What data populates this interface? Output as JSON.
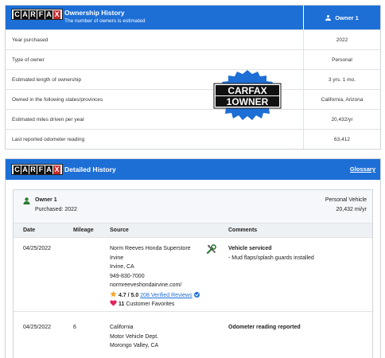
{
  "logo_text": "CARFAX",
  "ownership": {
    "title": "Ownership History",
    "subtitle": "The number of owners is estimated",
    "owner_column": "Owner 1",
    "rows": [
      {
        "label": "Year purchased",
        "value": "2022"
      },
      {
        "label": "Type of owner",
        "value": "Personal"
      },
      {
        "label": "Estimated length of ownership",
        "value": "3 yrs. 1 mo."
      },
      {
        "label": "Owned in the following states/provinces",
        "value": "California, Arizona"
      },
      {
        "label": "Estimated miles driven per year",
        "value": "20,432/yr"
      },
      {
        "label": "Last reported odometer reading",
        "value": "63,412"
      }
    ],
    "badge": {
      "line1": "CARFAX",
      "line2": "1OWNER"
    }
  },
  "detailed": {
    "title": "Detailed History",
    "glossary": "Glossary",
    "owner": {
      "name": "Owner 1",
      "purchased": "Purchased: 2022",
      "type": "Personal Vehicle",
      "miles": "20,432 mi/yr"
    },
    "columns": {
      "date": "Date",
      "mileage": "Mileage",
      "source": "Source",
      "comments": "Comments"
    },
    "records": [
      {
        "date": "04/25/2022",
        "mileage": "",
        "source": [
          "Norm Reeves Honda Superstore",
          "Irvine",
          "Irvine, CA",
          "949-830-7000",
          "normreeveshondairvine.com/"
        ],
        "rating": "4.7 / 5.0",
        "reviews": "208 Verified Reviews",
        "favorites_count": "11",
        "favorites_label": "Customer Favorites",
        "comment_title": "Vehicle serviced",
        "comment_detail": "- Mud flaps/splash guards installed"
      },
      {
        "date": "04/25/2022",
        "mileage": "6",
        "source": [
          "California",
          "Motor Vehicle Dept.",
          "Morongo Valley, CA"
        ],
        "comment_title": "Odometer reading reported"
      }
    ]
  },
  "colors": {
    "brand_blue": "#1d6fd6",
    "star": "#f5a623",
    "heart": "#e0245e",
    "tool": "#2e7d32"
  }
}
